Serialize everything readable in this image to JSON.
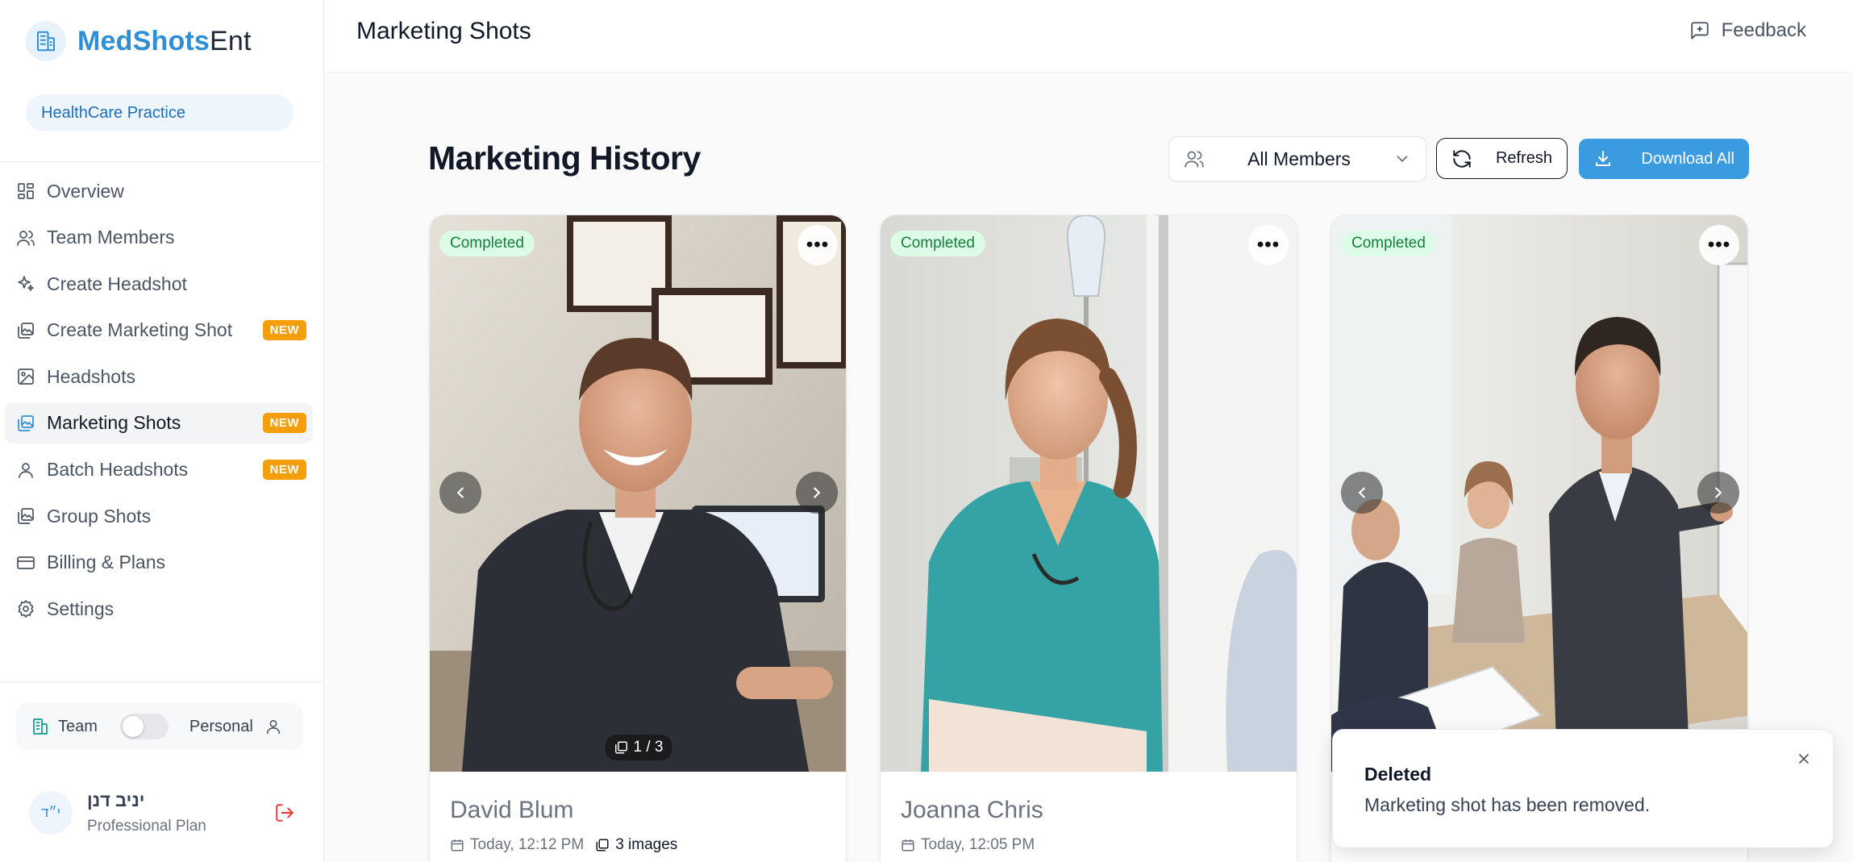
{
  "brand": {
    "name_main": "MedShots",
    "name_suffix": "Ent"
  },
  "practice": {
    "label": "HealthCare Practice"
  },
  "sidebar": {
    "items": [
      {
        "label": "Overview",
        "icon": "grid-icon",
        "new": false
      },
      {
        "label": "Team Members",
        "icon": "users-icon",
        "new": false
      },
      {
        "label": "Create Headshot",
        "icon": "sparkle-icon",
        "new": false
      },
      {
        "label": "Create Marketing Shot",
        "icon": "images-icon",
        "new": true
      },
      {
        "label": "Headshots",
        "icon": "image-icon",
        "new": false
      },
      {
        "label": "Marketing Shots",
        "icon": "images-icon",
        "new": true,
        "active": true
      },
      {
        "label": "Batch Headshots",
        "icon": "user-icon",
        "new": true
      },
      {
        "label": "Group Shots",
        "icon": "images-icon",
        "new": false
      },
      {
        "label": "Billing & Plans",
        "icon": "credit-card-icon",
        "new": false
      },
      {
        "label": "Settings",
        "icon": "gear-icon",
        "new": false
      }
    ],
    "new_badge": "NEW",
    "mode": {
      "team_label": "Team",
      "personal_label": "Personal"
    },
    "user": {
      "initials": "י״ד",
      "name": "יניב דנן",
      "plan": "Professional Plan"
    }
  },
  "header": {
    "title": "Marketing Shots",
    "feedback_label": "Feedback"
  },
  "main": {
    "title": "Marketing History",
    "member_filter": "All Members",
    "refresh_label": "Refresh",
    "download_label": "Download All"
  },
  "cards": [
    {
      "status": "Completed",
      "name": "David Blum",
      "time": "Today, 12:12 PM",
      "images": "3 images",
      "counter": "1 / 3"
    },
    {
      "status": "Completed",
      "name": "Joanna Chris",
      "time": "Today, 12:05 PM"
    },
    {
      "status": "Completed"
    }
  ],
  "toast": {
    "title": "Deleted",
    "message": "Marketing shot has been removed."
  },
  "colors": {
    "accent": "#3b9be0",
    "brand": "#2f8fd6",
    "success_bg": "#dcfce7",
    "success_text": "#16803c",
    "badge_new": "#f59e0b"
  }
}
